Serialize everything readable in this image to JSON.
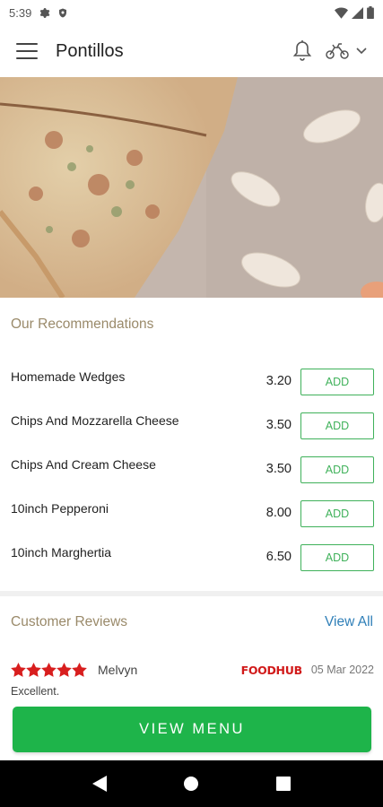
{
  "status_bar": {
    "time": "5:39",
    "icons": [
      "gear-icon",
      "shield-icon",
      "wifi-icon",
      "signal-icon",
      "battery-icon"
    ]
  },
  "app_bar": {
    "title": "Pontillos",
    "icons": [
      "hamburger-menu-icon",
      "bell-icon",
      "scooter-icon",
      "chevron-down-icon"
    ]
  },
  "hero": {
    "description_icon": "pizza-hero-image"
  },
  "recommendations": {
    "title": "Our Recommendations",
    "add_label": "ADD",
    "items": [
      {
        "name": "Homemade Wedges",
        "price": "3.20"
      },
      {
        "name": "Chips And Mozzarella Cheese",
        "price": "3.50"
      },
      {
        "name": "Chips And Cream Cheese",
        "price": "3.50"
      },
      {
        "name": "10inch Pepperoni",
        "price": "8.00"
      },
      {
        "name": "10inch Marghertia",
        "price": "6.50"
      }
    ]
  },
  "reviews": {
    "title": "Customer Reviews",
    "view_all": "View All",
    "items": [
      {
        "rating": 5,
        "reviewer": "Melvyn",
        "source": "FOODHUB",
        "date": "05 Mar 2022",
        "text": "Excellent."
      }
    ]
  },
  "cta": {
    "view_menu": "VIEW MENU"
  },
  "nav_bar": {
    "icons": [
      "back-icon",
      "home-icon",
      "recents-icon"
    ]
  },
  "colors": {
    "accent_green": "#1eb44a",
    "add_border_green": "#3fb15a",
    "section_title": "#9a8a6a",
    "link_blue": "#2f7fb8",
    "star_red": "#d81e1e",
    "foodhub_red": "#d11a1a"
  }
}
